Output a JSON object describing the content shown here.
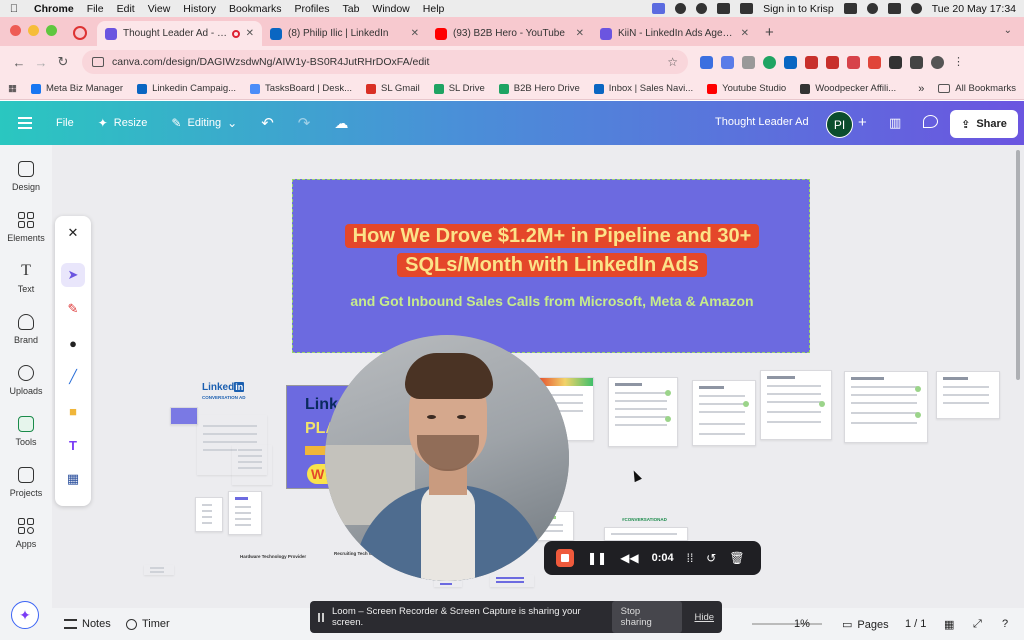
{
  "menubar": {
    "app": "Chrome",
    "items": [
      "File",
      "Edit",
      "View",
      "History",
      "Bookmarks",
      "Profiles",
      "Tab",
      "Window",
      "Help"
    ],
    "krisp": "Sign in to Krisp",
    "datetime": "Tue 20 May  17:34"
  },
  "tabs": [
    {
      "title": "Thought Leader Ad - Whi",
      "color": "#6b55e0",
      "active": true
    },
    {
      "title": "(8) Philip Ilic | LinkedIn",
      "color": "#0a66c2"
    },
    {
      "title": "(93) B2B Hero - YouTube",
      "color": "#ff0000"
    },
    {
      "title": "KiiN - LinkedIn Ads Agency",
      "color": "#6b55e0"
    }
  ],
  "address": {
    "url": "canva.com/design/DAGIWzsdwNg/AIW1y-BS0R4JutRHrDOxFA/edit"
  },
  "bookmarks": [
    {
      "label": "Meta Biz Manager",
      "color": "#1877f2"
    },
    {
      "label": "Linkedin Campaig...",
      "color": "#0a66c2"
    },
    {
      "label": "TasksBoard | Desk...",
      "color": "#4b8df8"
    },
    {
      "label": "SL Gmail",
      "color": "#d93025"
    },
    {
      "label": "SL Drive",
      "color": "#1fa463"
    },
    {
      "label": "B2B Hero Drive",
      "color": "#1fa463"
    },
    {
      "label": "Inbox | Sales Navi...",
      "color": "#0a66c2"
    },
    {
      "label": "Youtube Studio",
      "color": "#ff0000"
    },
    {
      "label": "Woodpecker Affili...",
      "color": "#333333"
    }
  ],
  "bookmarks_more": "»",
  "bookmarks_all": "All Bookmarks",
  "canva": {
    "file": "File",
    "resize": "Resize",
    "editing": "Editing",
    "doc_title": "Thought Leader Ad",
    "avatar": "PI",
    "share": "Share"
  },
  "sidebar": [
    {
      "label": "Design"
    },
    {
      "label": "Elements"
    },
    {
      "label": "Text"
    },
    {
      "label": "Brand"
    },
    {
      "label": "Uploads"
    },
    {
      "label": "Tools"
    },
    {
      "label": "Projects"
    },
    {
      "label": "Apps"
    }
  ],
  "artboard": {
    "headline": "How We Drove $1.2M+ in Pipeline and 30+ SQLs/Month with LinkedIn Ads",
    "subhead": "and Got Inbound Sales Calls from Microsoft, Meta & Amazon"
  },
  "thumbs": {
    "linked": "Linked",
    "in": "in",
    "conversation": "CONVERSATION AD",
    "planet_line1": "Link",
    "planet_line2": "PLA",
    "planet_bubble": "W",
    "label_a": "Hardware Technology Provider",
    "label_b": "Recruiting Tech Comp",
    "label_c": "#CONVERSATIONAD"
  },
  "recorder": {
    "time": "0:04"
  },
  "bottom": {
    "notes": "Notes",
    "timer": "Timer",
    "zoom": "1%",
    "pages": "Pages",
    "page_count": "1 / 1"
  },
  "share_banner": {
    "text": "Loom – Screen Recorder & Screen Capture is sharing your screen.",
    "stop": "Stop sharing",
    "hide": "Hide"
  }
}
